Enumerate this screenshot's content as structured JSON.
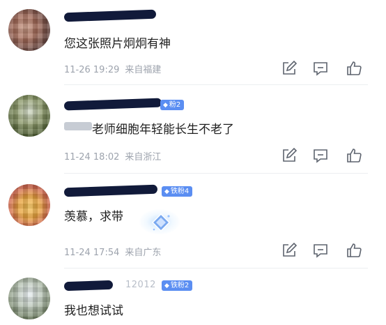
{
  "comments": [
    {
      "name_visible_suffix": "",
      "badge": "",
      "text": "您这张照片炯炯有神",
      "date": "11-26 19:29",
      "location": "来自福建"
    },
    {
      "name_visible_suffix": "",
      "badge": "粉2",
      "text": "老师细胞年轻能长生不老了",
      "date": "11-24 18:02",
      "location": "来自浙江"
    },
    {
      "name_visible_suffix": "",
      "badge": "铁粉4",
      "text": "羡慕，求带",
      "date": "11-24 17:54",
      "location": "来自广东"
    },
    {
      "name_visible_suffix": "12012",
      "badge": "铁粉2",
      "text": "我也想试试",
      "date": "",
      "location": ""
    }
  ],
  "icons": [
    "edit-icon",
    "reply-comment-icon",
    "thumbs-up-icon",
    "sparkle-gem-sticker"
  ],
  "colors": {
    "badge": "#5b8ef2",
    "meta": "#9da3ad",
    "text": "#1f1f1f",
    "redaction": "#111a3a"
  }
}
